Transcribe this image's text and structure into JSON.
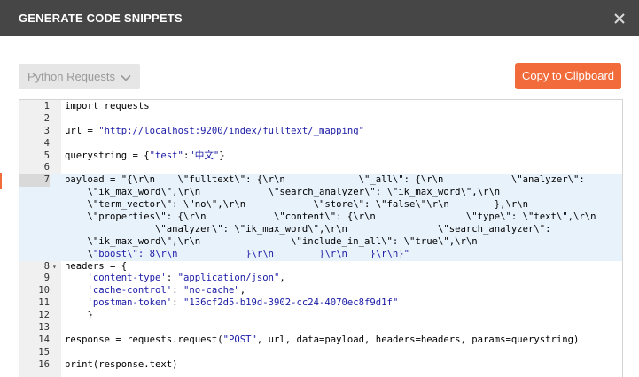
{
  "header": {
    "title": "GENERATE CODE SNIPPETS",
    "close_icon": "close-icon"
  },
  "language_select": {
    "value": "Python Requests",
    "icon": "chevron-down-icon"
  },
  "copy_button": {
    "label": "Copy to Clipboard",
    "color": "#f26b3a"
  },
  "editor": {
    "active_line": 7,
    "lines": [
      {
        "num": "1",
        "fold": "",
        "text": "import requests"
      },
      {
        "num": "2",
        "fold": "",
        "text": ""
      },
      {
        "num": "3",
        "fold": "",
        "text": "url = \"http://localhost:9200/index/fulltext/_mapping\""
      },
      {
        "num": "4",
        "fold": "",
        "text": ""
      },
      {
        "num": "5",
        "fold": "",
        "text": "querystring = {\"test\":\"中文\"}"
      },
      {
        "num": "6",
        "fold": "",
        "text": ""
      },
      {
        "num": "7",
        "fold": "",
        "text": "payload = \"{\\r\\n    \\\"fulltext\\\": {\\r\\n             \\\"_all\\\": {\\r\\n            \\\"analyzer\\\":"
      },
      {
        "num": "",
        "fold": "",
        "text": "    \\\"ik_max_word\\\",\\r\\n            \\\"search_analyzer\\\": \\\"ik_max_word\\\",\\r\\n"
      },
      {
        "num": "",
        "fold": "",
        "text": "    \\\"term_vector\\\": \\\"no\\\",\\r\\n            \\\"store\\\": \\\"false\\\"\\r\\n        },\\r\\n"
      },
      {
        "num": "",
        "fold": "",
        "text": "    \\\"properties\\\": {\\r\\n            \\\"content\\\": {\\r\\n                \\\"type\\\": \\\"text\\\",\\r\\n"
      },
      {
        "num": "",
        "fold": "",
        "text": "                \\\"analyzer\\\": \\\"ik_max_word\\\",\\r\\n                \\\"search_analyzer\\\":"
      },
      {
        "num": "",
        "fold": "",
        "text": "    \\\"ik_max_word\\\",\\r\\n                \\\"include_in_all\\\": \\\"true\\\",\\r\\n"
      },
      {
        "num": "",
        "fold": "",
        "text": "    \\\"boost\\\": 8\\r\\n            }\\r\\n        }\\r\\n    }\\r\\n}\""
      },
      {
        "num": "8",
        "fold": "▾",
        "text": "headers = {"
      },
      {
        "num": "9",
        "fold": "",
        "text": "    'content-type': \"application/json\","
      },
      {
        "num": "10",
        "fold": "",
        "text": "    'cache-control': \"no-cache\","
      },
      {
        "num": "11",
        "fold": "",
        "text": "    'postman-token': \"136cf2d5-b19d-3902-cc24-4070ec8f9d1f\""
      },
      {
        "num": "12",
        "fold": "",
        "text": "    }"
      },
      {
        "num": "13",
        "fold": "",
        "text": ""
      },
      {
        "num": "14",
        "fold": "",
        "text": "response = requests.request(\"POST\", url, data=payload, headers=headers, params=querystring)"
      },
      {
        "num": "15",
        "fold": "",
        "text": ""
      },
      {
        "num": "16",
        "fold": "",
        "text": "print(response.text)"
      }
    ]
  }
}
